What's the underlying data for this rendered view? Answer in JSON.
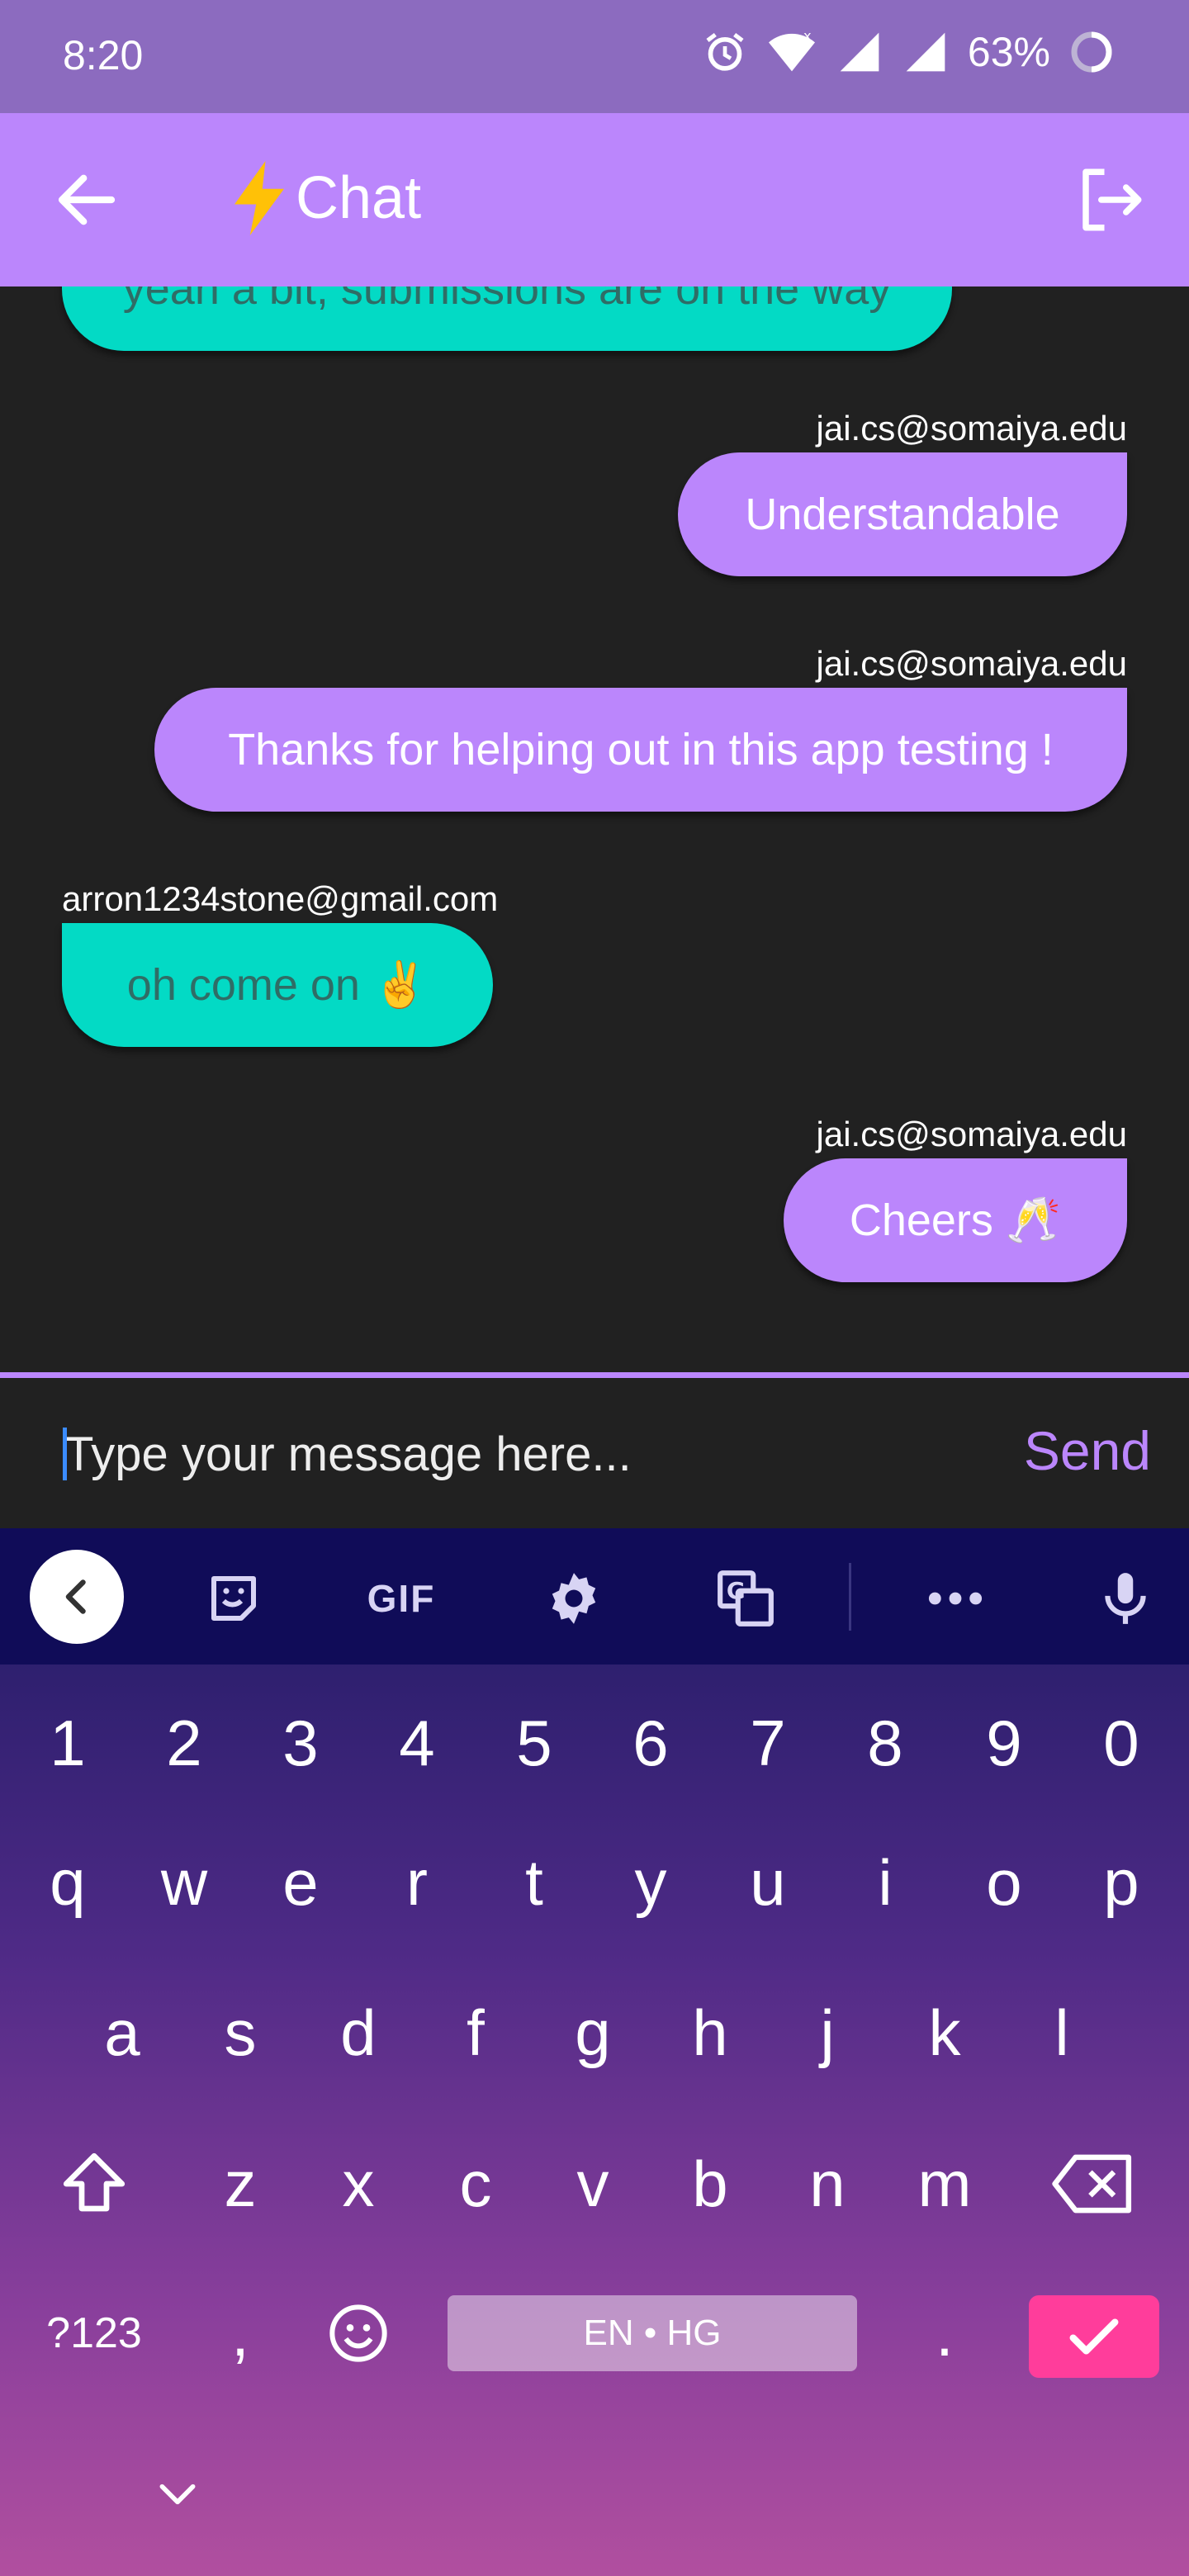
{
  "status_bar": {
    "time": "8:20",
    "battery": "63%",
    "icons": [
      "alarm-icon",
      "wifi-icon",
      "signal-icon",
      "signal-icon",
      "battery-icon"
    ]
  },
  "app_bar": {
    "title": "Chat",
    "title_icon": "lightning-icon",
    "back_icon": "arrow-left-icon",
    "logout_icon": "logout-icon"
  },
  "messages": [
    {
      "from_me": false,
      "sender": "",
      "text": "yeah a bit, submissions are on the way"
    },
    {
      "from_me": true,
      "sender": "jai.cs@somaiya.edu",
      "text": "Understandable"
    },
    {
      "from_me": true,
      "sender": "jai.cs@somaiya.edu",
      "text": "Thanks for helping out in this app testing !"
    },
    {
      "from_me": false,
      "sender": "arron1234stone@gmail.com",
      "text": "oh come on ✌️"
    },
    {
      "from_me": true,
      "sender": "jai.cs@somaiya.edu",
      "text": "Cheers 🥂"
    }
  ],
  "composer": {
    "placeholder": "Type your message here...",
    "value": "",
    "send_label": "Send"
  },
  "keyboard": {
    "toolbar": {
      "gif_label": "GIF",
      "icons": [
        "chevron-left-icon",
        "sticker-icon",
        "gif-icon",
        "settings-icon",
        "translate-icon",
        "more-icon",
        "microphone-icon"
      ]
    },
    "rows": {
      "numbers": [
        "1",
        "2",
        "3",
        "4",
        "5",
        "6",
        "7",
        "8",
        "9",
        "0"
      ],
      "row1": [
        "q",
        "w",
        "e",
        "r",
        "t",
        "y",
        "u",
        "i",
        "o",
        "p"
      ],
      "row2": [
        "a",
        "s",
        "d",
        "f",
        "g",
        "h",
        "j",
        "k",
        "l"
      ],
      "row3": [
        "z",
        "x",
        "c",
        "v",
        "b",
        "n",
        "m"
      ]
    },
    "symbols_label": "?123",
    "comma": ",",
    "period": ".",
    "space_label": "EN • HG"
  },
  "colors": {
    "status_bar": "#8c6bbf",
    "app_bar": "#bb86fc",
    "chat_bg": "#212121",
    "my_bubble": "#bb86fc",
    "their_bubble": "#03dac5",
    "their_text": "#2f6d66",
    "enter_key": "#ff3d9b"
  }
}
